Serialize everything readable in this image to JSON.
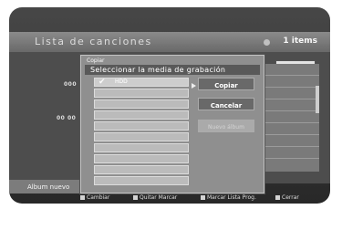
{
  "screen": {
    "title": "Lista de canciones",
    "item_count": "1 items"
  },
  "background": {
    "label_1": "000",
    "label_2": "00 00"
  },
  "album": {
    "label": "Album nuevo"
  },
  "dialog": {
    "title": "Copiar",
    "header": "Seleccionar la media de grabación",
    "media_items": [
      {
        "label": "HDD",
        "selected": true
      },
      {
        "label": "",
        "selected": false
      },
      {
        "label": "",
        "selected": false
      },
      {
        "label": "",
        "selected": false
      },
      {
        "label": "",
        "selected": false
      },
      {
        "label": "",
        "selected": false
      },
      {
        "label": "",
        "selected": false
      },
      {
        "label": "",
        "selected": false
      },
      {
        "label": "",
        "selected": false
      },
      {
        "label": "",
        "selected": false
      }
    ],
    "buttons": {
      "copy": "Copiar",
      "cancel": "Cancelar",
      "new_album": "Nuevo álbum"
    }
  },
  "hints": [
    {
      "label": "Cambiar",
      "color": "#cfcfcf"
    },
    {
      "label": "Quitar Marcar",
      "color": "#cfcfcf"
    },
    {
      "label": "Marcar Lista Prog.",
      "color": "#cfcfcf"
    },
    {
      "label": "Cerrar",
      "color": "#cfcfcf"
    }
  ]
}
